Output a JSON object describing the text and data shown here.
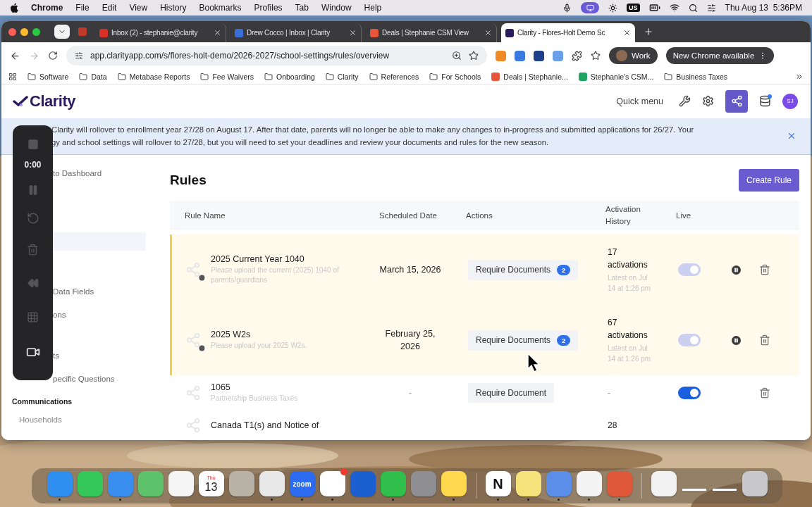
{
  "menu_bar": {
    "app": "Chrome",
    "menus": [
      "File",
      "Edit",
      "View",
      "History",
      "Bookmarks",
      "Profiles",
      "Tab",
      "Window",
      "Help"
    ],
    "keyboard": "US",
    "clock": "Thu Aug 13  5:36PM"
  },
  "browser": {
    "tabs": [
      {
        "title": "Inbox (2) - stephanie@clarity",
        "color": "#d93025",
        "selected": false
      },
      {
        "title": "Drew Cocco | Inbox | Clarity",
        "color": "#3b6fd8",
        "selected": false
      },
      {
        "title": "Deals | Stephanie CSM View",
        "color": "#e8553a",
        "selected": false
      },
      {
        "title": "Clarity - Flores-Holt Demo Sc",
        "color": "#2a1a5e",
        "selected": true
      }
    ],
    "url": "app.clarityapp.com/s/flores-holt-demo/2026-2027/school-settings/rules/overview",
    "profile": "Work",
    "update": "New Chrome available",
    "bookmarks": [
      {
        "kind": "folder",
        "label": "Software"
      },
      {
        "kind": "folder",
        "label": "Data"
      },
      {
        "kind": "folder",
        "label": "Metabase Reports"
      },
      {
        "kind": "folder",
        "label": "Fee Waivers"
      },
      {
        "kind": "folder",
        "label": "Onboarding"
      },
      {
        "kind": "folder",
        "label": "Clarity"
      },
      {
        "kind": "folder",
        "label": "References"
      },
      {
        "kind": "folder",
        "label": "For Schools"
      },
      {
        "kind": "link",
        "label": "Deals | Stephanie...",
        "color": "#e8553a"
      },
      {
        "kind": "link",
        "label": "Stephanie's CSM...",
        "color": "#1fa463"
      },
      {
        "kind": "folder",
        "label": "Business Taxes"
      }
    ]
  },
  "app": {
    "logo": "Clarity",
    "quick_menu": "Quick menu",
    "avatar": "SJ",
    "banner": {
      "lines": [
        "Clarity will rollover to enrollment year 27/28 on August 17. After that date, parents will no longer be able to make any changes to in-progress and submitted applications for 26/27. Your",
        "gy and school settings will rollover to 27/28, but you will need to set your deadlines and review your documents and rules for the new season."
      ]
    },
    "sidebar": {
      "items": [
        {
          "kind": "link",
          "label": "to Dashboard"
        },
        {
          "kind": "link",
          "label": "Data Fields"
        },
        {
          "kind": "link",
          "label": "ons"
        },
        {
          "kind": "link",
          "label": "ts"
        },
        {
          "kind": "link",
          "label": "pecific Questions"
        },
        {
          "kind": "heading",
          "label": "Communications"
        },
        {
          "kind": "item",
          "label": "Households"
        }
      ]
    },
    "title": "Rules",
    "create_button": "Create Rule",
    "table": {
      "columns": [
        "Rule Name",
        "Scheduled Date",
        "Actions",
        "Activation History",
        "Live"
      ],
      "rows": [
        {
          "name": "2025 Current Year 1040",
          "description": "Please upload the current (2025) 1040 of parents/guardians",
          "date": "March 15, 2026",
          "action": "Require Documents",
          "count": "2",
          "activations": "17 activations",
          "latest": "Latest on Jul 14 at 1:26 pm",
          "scheduled": true,
          "live": true
        },
        {
          "name": "2025 W2s",
          "description": "Please upload your 2025 W2s.",
          "date": "February 25, 2026",
          "action": "Require Documents",
          "count": "2",
          "activations": "67 activations",
          "latest": "Latest on Jul 14 at 1:26 pm",
          "scheduled": true,
          "live": true
        },
        {
          "name": "1065",
          "description": "Partnership Business Taxes",
          "date": "-",
          "action": "Require Document",
          "activations": "-",
          "scheduled": false,
          "live": true
        },
        {
          "name": "Canada T1(s) and Notice of",
          "activations": "28",
          "scheduled": false
        }
      ]
    }
  },
  "recorder": {
    "time": "0:00"
  },
  "dock": {
    "apps": [
      {
        "kind": "app",
        "color": "#2f8ff0",
        "running": true
      },
      {
        "kind": "app",
        "color": "#34c759",
        "running": false
      },
      {
        "kind": "app",
        "color": "#3a8ef0",
        "running": true
      },
      {
        "kind": "app",
        "color": "#5ec26a",
        "running": false
      },
      {
        "kind": "app",
        "color": "#f5f5f5",
        "running": false
      },
      {
        "kind": "calendar",
        "color": "#ffffff",
        "top": "Thu",
        "text": "13",
        "running": false
      },
      {
        "kind": "app",
        "color": "#b9b2a6",
        "running": false
      },
      {
        "kind": "app",
        "color": "#e8e8e8",
        "running": true
      },
      {
        "kind": "label",
        "color": "#2d6cf0",
        "text": "zoom",
        "running": true
      },
      {
        "kind": "app",
        "color": "#ffffff",
        "running": true
      },
      {
        "kind": "app",
        "color": "#1c5fd0",
        "running": false
      },
      {
        "kind": "app",
        "color": "#2fbf4a",
        "running": true
      },
      {
        "kind": "app",
        "color": "#8e8e93",
        "running": false
      },
      {
        "kind": "app",
        "color": "#ffd84d",
        "running": true
      },
      {
        "kind": "divider"
      },
      {
        "kind": "label",
        "color": "#ffffff",
        "text": "N",
        "running": true
      },
      {
        "kind": "app",
        "color": "#f6e27a",
        "running": true
      },
      {
        "kind": "app",
        "color": "#5b8ee8",
        "running": true
      },
      {
        "kind": "app",
        "color": "#f4f4f4",
        "running": true
      },
      {
        "kind": "app",
        "color": "#e0583a",
        "running": true
      },
      {
        "kind": "divider"
      },
      {
        "kind": "app",
        "color": "#f2f2f2",
        "running": false
      },
      {
        "kind": "window",
        "color": "#ffffff",
        "running": false
      },
      {
        "kind": "window",
        "color": "#ffffff",
        "running": false
      },
      {
        "kind": "app",
        "color": "#c8c8cc",
        "running": false
      }
    ]
  }
}
